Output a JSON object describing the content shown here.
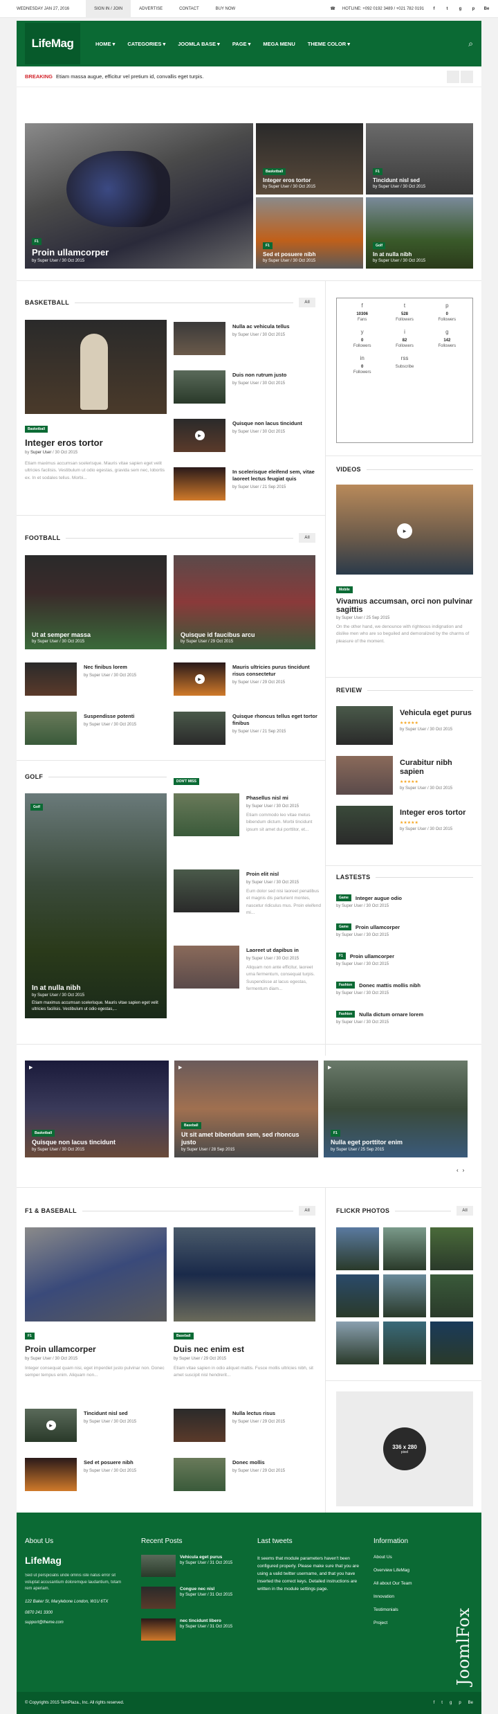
{
  "topbar": {
    "date": "WEDNESDAY JAN 27, 2016",
    "links": [
      "SIGN IN / JOIN",
      "ADVERTISE",
      "CONTACT",
      "BUY NOW"
    ],
    "hotline": "HOTLINE: +092 0192 3489 / +021 782 0191",
    "social": [
      "f",
      "t",
      "g",
      "p",
      "Be"
    ]
  },
  "header": {
    "logo": "LifeMag",
    "nav": [
      "HOME ▾",
      "CATEGORIES ▾",
      "JOOMLA BASE ▾",
      "PAGE ▾",
      "MEGA MENU",
      "THEME COLOR ▾"
    ]
  },
  "breaking": {
    "label": "BREAKING",
    "text": "Etiam massa augue, efficitur vel pretium id, convallis eget turpis."
  },
  "hero": {
    "main": {
      "badge": "F1",
      "title": "Proin ullamcorper",
      "meta": "by Super User / 30 Oct 2015"
    },
    "tiles": [
      {
        "badge": "Basketball",
        "title": "Integer eros tortor",
        "meta": "by Super User / 30 Oct 2015"
      },
      {
        "badge": "F1",
        "title": "Tincidunt nisl sed",
        "meta": "by Super User / 30 Oct 2015"
      },
      {
        "badge": "F1",
        "title": "Sed et posuere nibh",
        "meta": "by Super User / 30 Oct 2015"
      },
      {
        "badge": "Golf",
        "title": "In at nulla nibh",
        "meta": "by Super User / 30 Oct 2015"
      }
    ]
  },
  "basketball": {
    "title": "BASKETBALL",
    "all": "All",
    "main": {
      "badge": "Basketball",
      "title": "Integer eros tortor",
      "meta_by": "by",
      "meta_user": "Super User",
      "meta_date": "/ 30 Oct 2015",
      "text": "Etiam maximus accumsan scelerisque. Mauris vitae sapien eget velit ultricies facilisis. Vestibulum ut odio egestas, gravida sem nec, lobortis ex. In et sodales tellus. Morbi..."
    },
    "list": [
      {
        "title": "Nulla ac vehicula tellus",
        "meta": "by Super User / 30 Oct 2015"
      },
      {
        "title": "Duis non rutrum justo",
        "meta": "by Super User / 30 Oct 2015"
      },
      {
        "title": "Quisque non lacus tincidunt",
        "meta": "by Super User / 30 Oct 2015"
      },
      {
        "title": "In scelerisque eleifend sem, vitae laoreet lectus feugiat quis",
        "meta": "by Super User / 21 Sep 2015"
      }
    ]
  },
  "social": [
    {
      "icon": "f",
      "count": "10306",
      "label": "Fans"
    },
    {
      "icon": "t",
      "count": "528",
      "label": "Followers"
    },
    {
      "icon": "p",
      "count": "0",
      "label": "Followers"
    },
    {
      "icon": "y",
      "count": "0",
      "label": "Followers"
    },
    {
      "icon": "i",
      "count": "82",
      "label": "Followers"
    },
    {
      "icon": "g",
      "count": "142",
      "label": "Followers"
    },
    {
      "icon": "in",
      "count": "0",
      "label": "Followers"
    },
    {
      "icon": "rss",
      "count": "",
      "label": "Subscribe"
    }
  ],
  "videos": {
    "title": "VIDEOS",
    "badge": "Mobile",
    "headline": "Vivamus accumsan, orci non pulvinar sagittis",
    "meta": "by Super User / 25 Sep 2015",
    "text": "On the other hand, we denounce with righteous indignation and dislike men who are so beguiled and demoralized by the charms of pleasure of the moment."
  },
  "football": {
    "title": "FOOTBALL",
    "all": "All",
    "big": [
      {
        "title": "Ut at semper massa",
        "meta": "by Super User / 30 Oct 2015"
      },
      {
        "title": "Quisque id faucibus arcu",
        "meta": "by Super User / 29 Oct 2015"
      }
    ],
    "list": [
      {
        "title": "Nec finibus lorem",
        "meta": "by Super User / 30 Oct 2015"
      },
      {
        "title": "Mauris ultricies purus tincidunt risus consectetur",
        "meta": "by Super User / 29 Oct 2015"
      },
      {
        "title": "Suspendisse potenti",
        "meta": "by Super User / 30 Oct 2015"
      },
      {
        "title": "Quisque rhoncus tellus eget tortor finibus",
        "meta": "by Super User / 21 Sep 2015"
      }
    ]
  },
  "review": {
    "title": "REVIEW",
    "items": [
      {
        "title": "Vehicula eget purus",
        "meta": "by Super User / 30 Oct 2015"
      },
      {
        "title": "Curabitur nibh sapien",
        "meta": "by Super User / 30 Oct 2015"
      },
      {
        "title": "Integer eros tortor",
        "meta": "by Super User / 30 Oct 2015"
      }
    ]
  },
  "golf": {
    "title": "GOLF",
    "dontmiss": "DON'T MISS",
    "main": {
      "badge": "Golf",
      "title": "In at nulla nibh",
      "meta": "by Super User / 30 Oct 2015",
      "text": "Etiam maximus accumsan scelerisque. Mauris vitae sapien eget velit ultricies facilisis. Vestibulum ut odio egestas,..."
    },
    "list": [
      {
        "title": "Phasellus nisl mi",
        "meta": "by Super User / 30 Oct 2015",
        "text": "Etiam commodo leo vitae metus bibendum dictum. Morbi tincidunt ipsum sit amet dui porttitor, et..."
      },
      {
        "title": "Proin elit nisl",
        "meta": "by Super User / 30 Oct 2015",
        "text": "Eum dolor sed nisi laoreet penatibus et magnis dis parturient montes, nascetur ridiculus mus. Proin eleifend mi..."
      },
      {
        "title": "Laoreet ut dapibus in",
        "meta": "by Super User / 30 Oct 2015",
        "text": "Aliquam non ante efficitur, laoreet urna fermentum, consequat turpis. Suspendisse at lacus egestas, fermentum diam..."
      }
    ]
  },
  "lastests": {
    "title": "LASTESTS",
    "items": [
      {
        "badge": "Game",
        "title": "Integer augue odio",
        "meta": "by Super User / 30 Oct 2015"
      },
      {
        "badge": "Game",
        "title": "Proin ullamcorper",
        "meta": "by Super User / 30 Oct 2015"
      },
      {
        "badge": "F1",
        "title": "Proin ullamcorper",
        "meta": "by Super User / 30 Oct 2015"
      },
      {
        "badge": "Fashion",
        "title": "Donec mattis mollis nibh",
        "meta": "by Super User / 30 Oct 2015"
      },
      {
        "badge": "Fashion",
        "title": "Nulla dictum ornare lorem",
        "meta": "by Super User / 30 Oct 2015"
      }
    ]
  },
  "slider": [
    {
      "badge": "Basketball",
      "title": "Quisque non lacus tincidunt",
      "meta": "by Super User / 30 Oct 2015"
    },
    {
      "badge": "Baseball",
      "title": "Ut sit amet bibendum sem, sed rhoncus justo",
      "meta": "by Super User / 28 Sep 2015"
    },
    {
      "badge": "F1",
      "title": "Nulla eget porttitor enim",
      "meta": "by Super User / 25 Sep 2015"
    }
  ],
  "f1": {
    "title": "F1 & BASEBALL",
    "all": "All",
    "big": [
      {
        "badge": "F1",
        "title": "Proin ullamcorper",
        "meta": "by Super User / 30 Oct 2015",
        "text": "Integer consequat quam nisi, eget imperdiet justo pulvinar non. Donec semper tempus enim. Aliquam non..."
      },
      {
        "badge": "Baseball",
        "title": "Duis nec enim est",
        "meta": "by Super User / 29 Oct 2015",
        "text": "Etiam vitae sapien in odio aliquet mattis. Fusce mollis ultricies nibh, sit amet suscipit nisl hendrerit..."
      }
    ],
    "list": [
      {
        "title": "Tincidunt nisl sed",
        "meta": "by Super User / 30 Oct 2015"
      },
      {
        "title": "Nulla lectus risus",
        "meta": "by Super User / 29 Oct 2015"
      },
      {
        "title": "Sed et posuere nibh",
        "meta": "by Super User / 30 Oct 2015"
      },
      {
        "title": "Donec mollis",
        "meta": "by Super User / 29 Oct 2015"
      }
    ]
  },
  "flickr": {
    "title": "FLICKR PHOTOS",
    "all": "All"
  },
  "ad": {
    "size": "336 x 280",
    "unit": "pixel"
  },
  "footer": {
    "about": {
      "title": "About Us",
      "logo": "LifeMag",
      "text": "Sed ut perspiciatis unde omnis iste natus error sit voluptat accusantium doloremque laudantium, totam rem aperiam.",
      "address": "122 Baker St, Marylebone London, W1U 6TX",
      "phone": "0870 241 3300",
      "email": "support@theme.com"
    },
    "recent": {
      "title": "Recent Posts",
      "items": [
        {
          "title": "Vehicula eget purus",
          "meta": "by Super User / 31 Oct 2015"
        },
        {
          "title": "Congue nec nisl",
          "meta": "by Super User / 31 Oct 2015"
        },
        {
          "title": "nec tincidunt libero",
          "meta": "by Super User / 31 Oct 2015"
        }
      ]
    },
    "tweets": {
      "title": "Last tweets",
      "text": "It seems that module parameters haven't been configured properly. Please make sure that you are using a valid twitter username, and that you have inserted the correct keys. Detailed instructions are written in the module settings page."
    },
    "info": {
      "title": "Information",
      "items": [
        "About Us",
        "Overview LifeMag",
        "All about Our Team",
        "Innovation",
        "Testimonials",
        "Project"
      ]
    },
    "copyright": "© Copyrights 2015 TemPlaza., Inc. All rights reserved.",
    "brand": "JoomlFox"
  }
}
